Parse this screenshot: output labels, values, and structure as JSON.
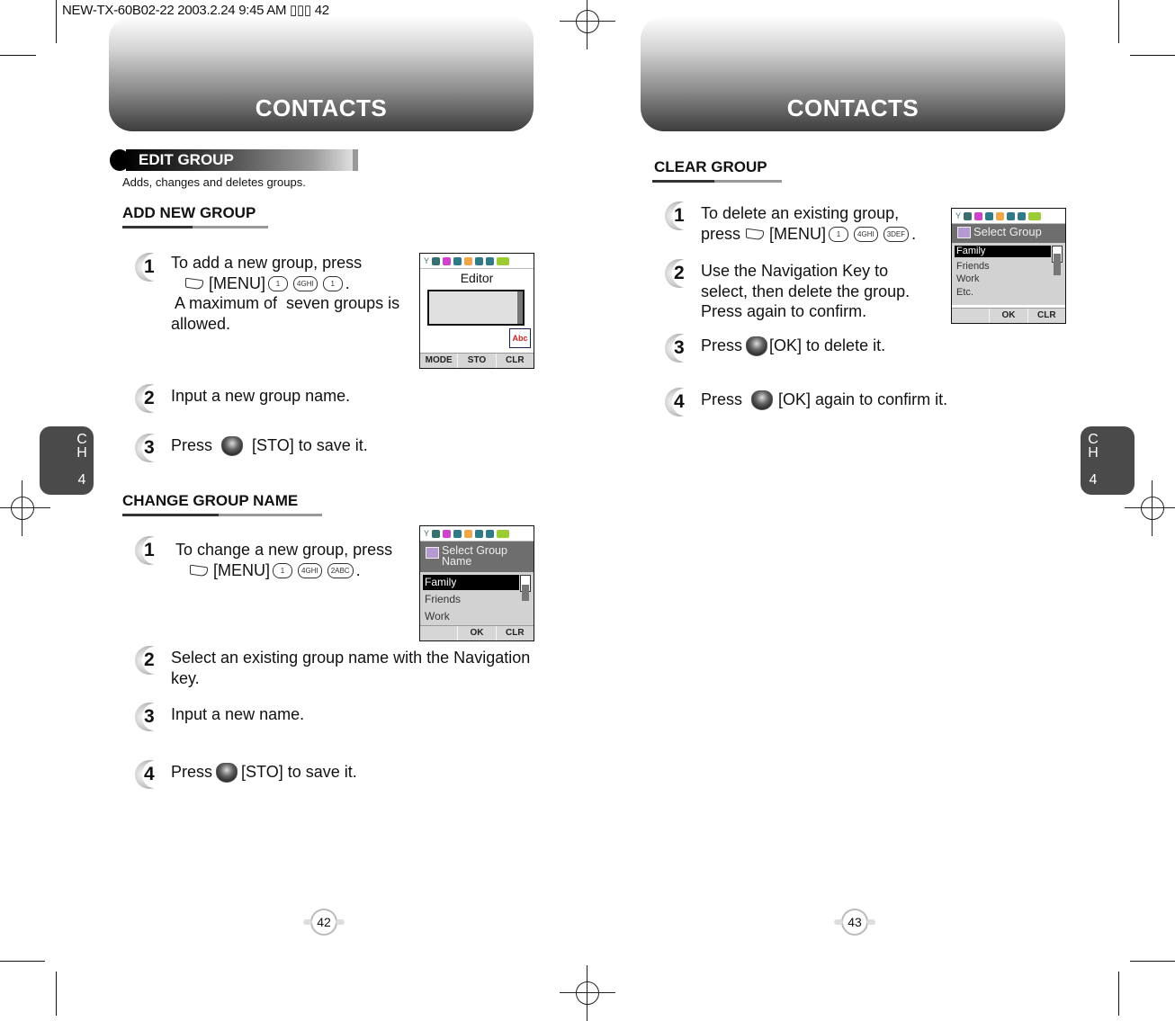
{
  "slug": "NEW-TX-60B02-22  2003.2.24 9:45 AM  ▯▯▯ 42",
  "left_page": {
    "banner_title": "CONTACTS",
    "chapter_tab": {
      "ch": "C\nH",
      "num": "4"
    },
    "section_pill": "EDIT GROUP",
    "section_subtitle": "Adds, changes and deletes groups.",
    "add_new_group": {
      "heading": "ADD NEW GROUP",
      "steps": [
        {
          "n": "1",
          "lines": [
            "To add a new group, press",
            "[MENU]",
            " A maximum of  seven groups is",
            "allowed."
          ],
          "keys": [
            "1",
            "4GHI",
            "1"
          ]
        },
        {
          "n": "2",
          "text": "Input a new group name."
        },
        {
          "n": "3",
          "pre": "Press",
          "post": "[STO] to save it."
        }
      ],
      "screen": {
        "title": "Editor",
        "softkeys": [
          "MODE",
          "STO",
          "CLR"
        ],
        "mode_icon": "Abc"
      }
    },
    "change_group_name": {
      "heading": "CHANGE GROUP NAME",
      "steps": [
        {
          "n": "1",
          "lines": [
            "To change a new group, press",
            "[MENU]"
          ],
          "keys": [
            "1",
            "4GHI",
            "2ABC"
          ]
        },
        {
          "n": "2",
          "lines": [
            "Select an existing group name with the Navigation",
            "key."
          ]
        },
        {
          "n": "3",
          "text": "Input a new name."
        },
        {
          "n": "4",
          "pre": "Press",
          "post": "[STO] to save it."
        }
      ],
      "screen": {
        "header": "Select Group Name",
        "items": [
          "Family",
          "Friends",
          "Work"
        ],
        "selected": 0,
        "softkeys": [
          "",
          "OK",
          "CLR"
        ]
      }
    },
    "page_number": "42"
  },
  "right_page": {
    "banner_title": "CONTACTS",
    "chapter_tab": {
      "ch": "C\nH",
      "num": "4"
    },
    "clear_group": {
      "heading": "CLEAR GROUP",
      "steps": [
        {
          "n": "1",
          "lines": [
            "To delete an existing group,",
            "press",
            "[MENU]"
          ],
          "keys": [
            "1",
            "4GHI",
            "3DEF"
          ]
        },
        {
          "n": "2",
          "lines": [
            "Use the Navigation Key to",
            "select, then delete the group.",
            "Press again to confirm."
          ]
        },
        {
          "n": "3",
          "pre": "Press",
          "post": "[OK] to delete it."
        },
        {
          "n": "4",
          "pre": "Press",
          "post": "[OK] again to confirm it."
        }
      ],
      "screen": {
        "header": "Select Group",
        "items": [
          "Family",
          "Friends",
          "Work",
          "Etc."
        ],
        "selected": 0,
        "softkeys": [
          "",
          "OK",
          "CLR"
        ]
      }
    },
    "page_number": "43"
  },
  "status_icon_colors": [
    "#3a6f6f",
    "#3a6f6f",
    "#cc44cc",
    "#2f7a86",
    "#f2a64a",
    "#2f7a86",
    "#2f7a86",
    "#9ccc33"
  ]
}
